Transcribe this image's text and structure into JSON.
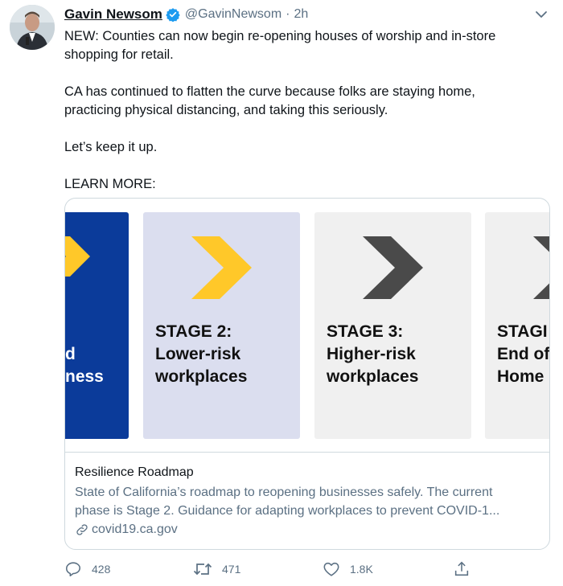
{
  "author": {
    "name": "Gavin Newsom",
    "handle": "@GavinNewsom",
    "separator": "·",
    "time": "2h"
  },
  "tweet": {
    "line1": "NEW: Counties can now begin re-opening houses of worship and in-store",
    "line2": "shopping for retail.",
    "line3": "CA has continued to flatten the curve because folks are staying home,",
    "line4": "practicing physical distancing, and taking this seriously.",
    "line5": "Let’s keep it up.",
    "line6": "LEARN MORE:"
  },
  "card": {
    "slides": [
      {
        "line1": "d",
        "line2": "ness",
        "bg": "#0b3b9a",
        "chevron": "#ffc829"
      },
      {
        "line1": "STAGE 2:",
        "line2": "Lower-risk",
        "line3": "workplaces",
        "bg": "#dbdeef",
        "chevron": "#ffc829"
      },
      {
        "line1": "STAGE 3:",
        "line2": "Higher-risk",
        "line3": "workplaces",
        "bg": "#f0f0f0",
        "chevron": "#4a4a4a"
      },
      {
        "line1": "STAGI",
        "line2": "End of",
        "line3": "Home",
        "bg": "#f0f0f0",
        "chevron": "#4a4a4a"
      }
    ],
    "title": "Resilience Roadmap",
    "desc_line1": "State of California’s roadmap to reopening businesses safely. The current",
    "desc_line2": "phase is Stage 2. Guidance for adapting workplaces to prevent COVID-1...",
    "link": "covid19.ca.gov"
  },
  "actions": {
    "replies": "428",
    "retweets": "471",
    "likes": "1.8K"
  },
  "colors": {
    "verified": "#1d9bf0",
    "muted": "#5b7083",
    "border": "#cfd9de"
  },
  "icons": [
    "verified-badge-icon",
    "chevron-down-icon",
    "link-icon",
    "reply-icon",
    "retweet-icon",
    "like-icon",
    "share-icon"
  ]
}
